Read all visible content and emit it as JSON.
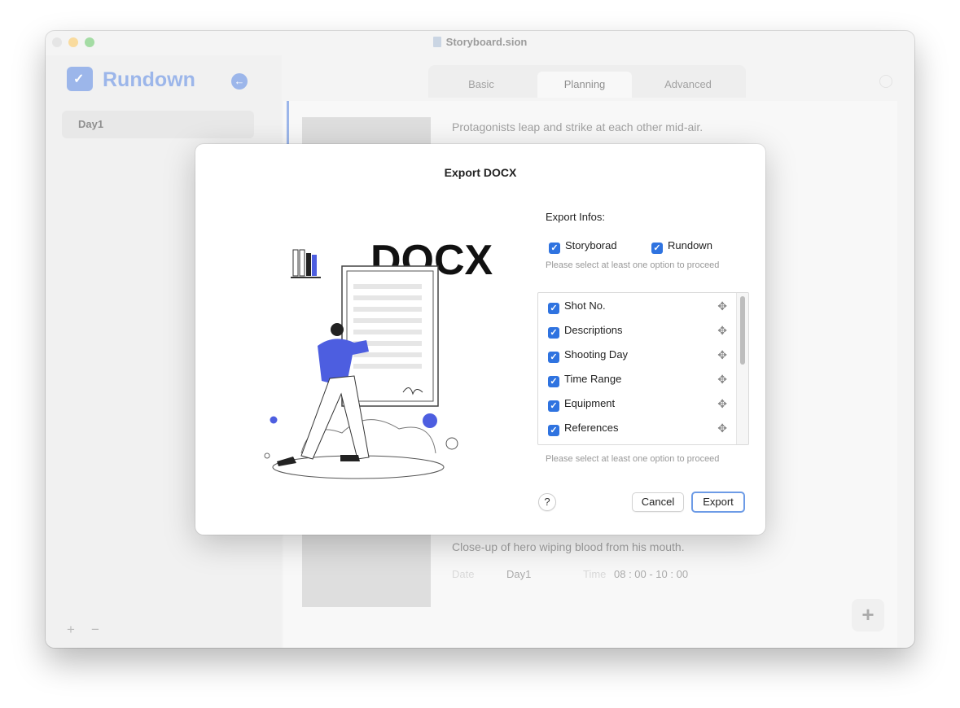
{
  "window": {
    "title": "Storyboard.sion",
    "traffic_lights": [
      "#c9c9c9",
      "#f5bd4f",
      "#5ac05a"
    ]
  },
  "sidebar": {
    "app_name": "Rundown",
    "logo_icon": "calendar-check-icon",
    "collapse_icon": "arrow-left-circle-icon",
    "days": [
      "Day1"
    ],
    "add_label": "+",
    "remove_label": "−"
  },
  "tabs": [
    "Basic",
    "Planning",
    "Advanced"
  ],
  "active_tab": "Planning",
  "storyboard": {
    "rows": [
      {
        "description": "Protagonists leap and strike at each other mid-air."
      },
      {
        "description": "Close-up of hero wiping blood from his mouth.",
        "date_label": "Date",
        "day": "Day1",
        "time_label": "Time",
        "time_range": "08 : 00 - 10 : 00"
      }
    ],
    "add_button": "+"
  },
  "dialog": {
    "title": "Export DOCX",
    "illustration_text": "DOCX",
    "export_infos_label": "Export Infos:",
    "options": [
      {
        "label": "Storyborad",
        "checked": true
      },
      {
        "label": "Rundown",
        "checked": true
      }
    ],
    "hint_top": "Please select at least one option to proceed",
    "fields": [
      {
        "label": "Shot No.",
        "checked": true
      },
      {
        "label": "Descriptions",
        "checked": true
      },
      {
        "label": "Shooting Day",
        "checked": true
      },
      {
        "label": "Time Range",
        "checked": true
      },
      {
        "label": "Equipment",
        "checked": true
      },
      {
        "label": "References",
        "checked": true
      }
    ],
    "hint_bottom": "Please select at least one option to proceed",
    "help_label": "?",
    "cancel_label": "Cancel",
    "export_label": "Export"
  },
  "colors": {
    "accent": "#4b7bd9",
    "checkbox": "#2f73e0",
    "illustration_blue": "#4d5ee0"
  }
}
